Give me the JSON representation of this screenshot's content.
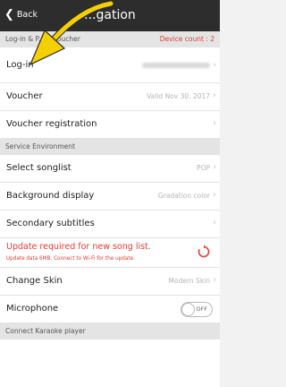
{
  "header": {
    "back_label": "Back",
    "title": "...gation"
  },
  "sections": {
    "login_voucher": "Log-in & P... e voucher",
    "device_count": "Device count : 2",
    "service_env": "Service Environment",
    "connect": "Connect Karaoke player"
  },
  "rows": {
    "login": {
      "label": "Log-in"
    },
    "voucher": {
      "label": "Voucher",
      "value": "Valid  Nov 30, 2017"
    },
    "voucher_registration": {
      "label": "Voucher registration"
    },
    "songlist": {
      "label": "Select songlist",
      "value": "POP"
    },
    "background": {
      "label": "Background display",
      "value": "Gradation color"
    },
    "subtitles": {
      "label": "Secondary subtitles"
    },
    "update": {
      "label": "Update required for new song list.",
      "sub": "Update data 6MB. Connect to Wi-Fi for the update."
    },
    "skin": {
      "label": "Change Skin",
      "value": "Modern Skin"
    },
    "microphone": {
      "label": "Microphone",
      "toggle": "OFF"
    }
  },
  "icons": {
    "back": "chevron-left-icon",
    "chevron": "chevron-right-icon",
    "refresh": "refresh-icon",
    "pointer": "yellow-arrow-annotation"
  },
  "colors": {
    "topbar": "#2d2d2d",
    "accent_red": "#e53935",
    "annotation": "#f5d000"
  }
}
